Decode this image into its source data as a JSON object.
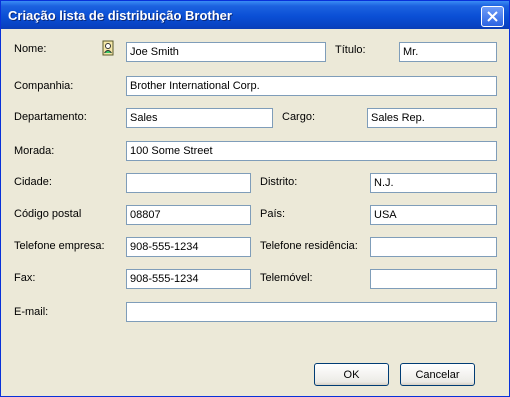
{
  "window": {
    "title": "Criação lista de distribuição Brother"
  },
  "form": {
    "nome": {
      "label": "Nome:",
      "value": "Joe Smith"
    },
    "titulo": {
      "label": "Título:",
      "value": "Mr."
    },
    "companhia": {
      "label": "Companhia:",
      "value": "Brother International Corp."
    },
    "departamento": {
      "label": "Departamento:",
      "value": "Sales"
    },
    "cargo": {
      "label": "Cargo:",
      "value": "Sales Rep."
    },
    "morada": {
      "label": "Morada:",
      "value": "100 Some Street"
    },
    "cidade": {
      "label": "Cidade:",
      "value": ""
    },
    "distrito": {
      "label": "Distrito:",
      "value": "N.J."
    },
    "codigo_postal": {
      "label": "Código postal",
      "value": "08807"
    },
    "pais": {
      "label": "País:",
      "value": "USA"
    },
    "telefone_empresa": {
      "label": "Telefone empresa:",
      "value": "908-555-1234"
    },
    "telefone_residencia": {
      "label": "Telefone residência:",
      "value": ""
    },
    "fax": {
      "label": "Fax:",
      "value": "908-555-1234"
    },
    "telemovel": {
      "label": "Telemóvel:",
      "value": ""
    },
    "email": {
      "label": "E-mail:",
      "value": ""
    }
  },
  "buttons": {
    "ok": "OK",
    "cancel": "Cancelar"
  },
  "icons": {
    "address_book": "address-book-icon",
    "close": "close-icon"
  }
}
